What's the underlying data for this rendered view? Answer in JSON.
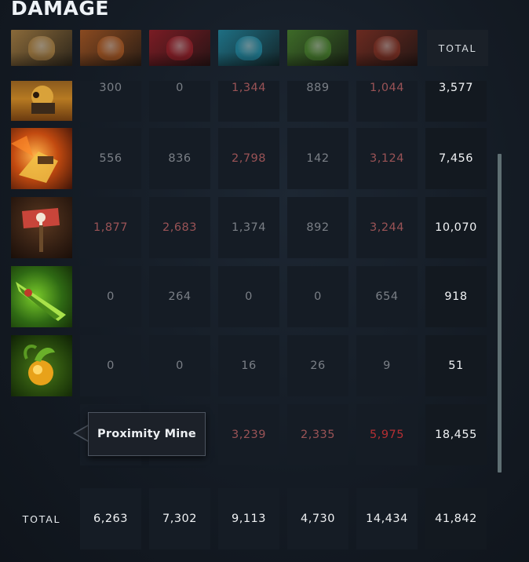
{
  "header": {
    "title": "DAMAGE",
    "total_label": "TOTAL"
  },
  "heroes": [
    {
      "name": "techies-portrait-icon",
      "color": "#8a6a3a"
    },
    {
      "name": "bristleback-portrait-icon",
      "color": "#8a4a20"
    },
    {
      "name": "lion-portrait-icon",
      "color": "#7a1c24"
    },
    {
      "name": "razor-portrait-icon",
      "color": "#1e6f83"
    },
    {
      "name": "necrophos-portrait-icon",
      "color": "#3d6a28"
    },
    {
      "name": "axe-portrait-icon",
      "color": "#6a2a20"
    }
  ],
  "rows": [
    {
      "ability": "blast-off-icon",
      "values": [
        "300",
        "0",
        "1,344",
        "889",
        "1,044"
      ],
      "total": "3,577",
      "styles": [
        "dim",
        "dim",
        "red",
        "dim",
        "red"
      ]
    },
    {
      "ability": "stasis-trap-icon",
      "values": [
        "556",
        "836",
        "2,798",
        "142",
        "3,124"
      ],
      "total": "7,456",
      "styles": [
        "dim",
        "dim",
        "red",
        "dim",
        "red"
      ]
    },
    {
      "ability": "minefield-sign-icon",
      "values": [
        "1,877",
        "2,683",
        "1,374",
        "892",
        "3,244"
      ],
      "total": "10,070",
      "styles": [
        "red",
        "red",
        "dim",
        "dim",
        "red"
      ]
    },
    {
      "ability": "green-blade-item-icon",
      "values": [
        "0",
        "264",
        "0",
        "0",
        "654"
      ],
      "total": "918",
      "styles": [
        "dim",
        "dim",
        "dim",
        "dim",
        "dim"
      ]
    },
    {
      "ability": "glowing-fruit-item-icon",
      "values": [
        "0",
        "0",
        "16",
        "26",
        "9"
      ],
      "total": "51",
      "styles": [
        "dim",
        "dim",
        "dim",
        "dim",
        "dim"
      ]
    },
    {
      "ability": "proximity-mine-row",
      "values": [
        "",
        "",
        "3,239",
        "2,335",
        "5,975"
      ],
      "total": "18,455",
      "styles": [
        "dim",
        "dim",
        "red",
        "red",
        "bright"
      ]
    }
  ],
  "footer": {
    "label": "TOTAL",
    "values": [
      "6,263",
      "7,302",
      "9,113",
      "4,730",
      "14,434"
    ],
    "grand_total": "41,842"
  },
  "tooltip": {
    "text": "Proximity Mine"
  }
}
